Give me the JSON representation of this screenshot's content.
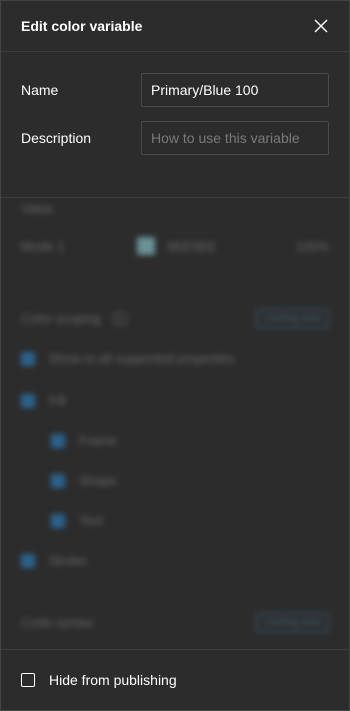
{
  "dialog": {
    "title": "Edit color variable",
    "close_icon": "close-icon"
  },
  "fields": {
    "name_label": "Name",
    "name_value": "Primary/Blue 100",
    "description_label": "Description",
    "description_placeholder": "How to use this variable"
  },
  "value_section": {
    "heading": "Value",
    "mode_label": "Mode 1",
    "hex": "9EE5EE",
    "opacity": "100%",
    "swatch_color": "#9ee5ee"
  },
  "scoping": {
    "heading": "Color scoping",
    "badge": "Coming soon",
    "items": [
      {
        "label": "Show in all supported properties",
        "indent": 0
      },
      {
        "label": "Fill",
        "indent": 0
      },
      {
        "label": "Frame",
        "indent": 1
      },
      {
        "label": "Shape",
        "indent": 1
      },
      {
        "label": "Text",
        "indent": 1
      },
      {
        "label": "Stroke",
        "indent": 0
      }
    ]
  },
  "code_syntax": {
    "heading": "Code syntax",
    "badge": "Coming soon"
  },
  "footer": {
    "hide_label": "Hide from publishing",
    "hide_checked": false
  },
  "colors": {
    "background": "#2c2c2c",
    "accent": "#2b8fde"
  }
}
